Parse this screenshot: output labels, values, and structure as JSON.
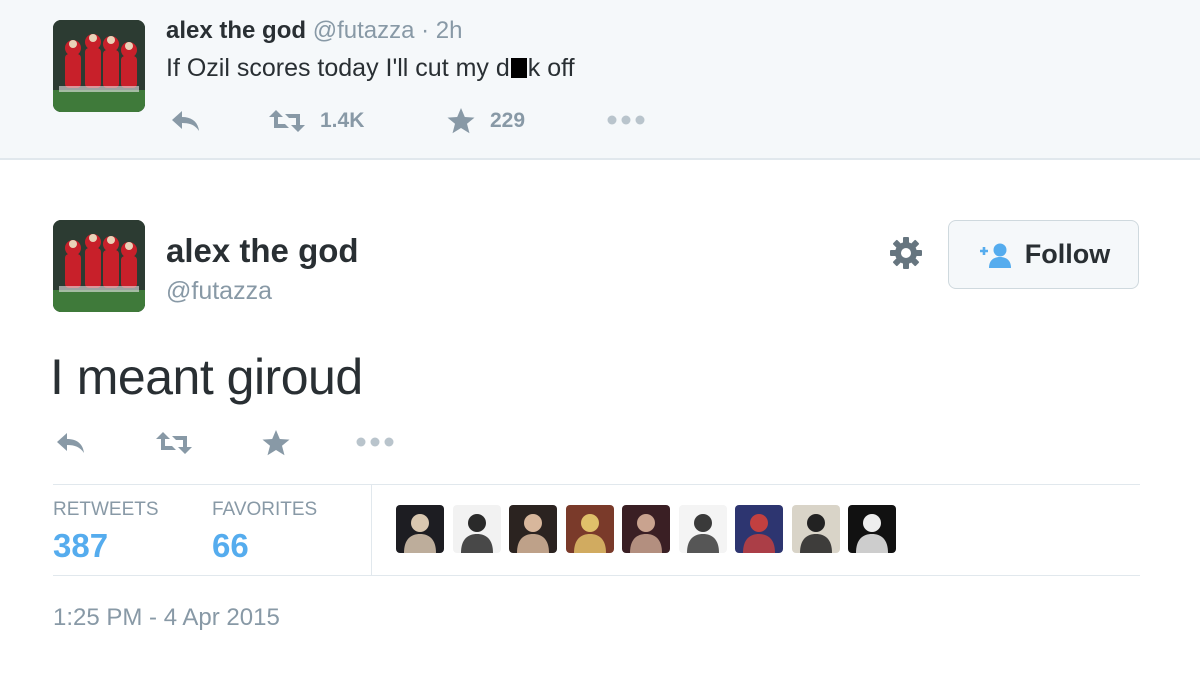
{
  "parent_tweet": {
    "name": "alex the god",
    "handle": "@futazza",
    "separator": "·",
    "time": "2h",
    "text_before": "If Ozil scores today I'll cut my d",
    "text_after": "k off",
    "retweets": "1.4K",
    "favorites": "229",
    "icons": [
      "reply-icon",
      "retweet-icon",
      "star-icon",
      "more-icon"
    ]
  },
  "main_tweet": {
    "name": "alex the god",
    "handle": "@futazza",
    "follow_label": "Follow",
    "text": "I meant giroud",
    "icons": [
      "reply-icon",
      "retweet-icon",
      "star-icon",
      "more-icon"
    ],
    "stats": {
      "retweets_label": "RETWEETS",
      "retweets_value": "387",
      "favorites_label": "FAVORITES",
      "favorites_value": "66"
    },
    "favoriters": [
      {
        "name": "favoriter-avatar-1",
        "bg": "#1d1d22",
        "fg": "#d9c7b0"
      },
      {
        "name": "favoriter-avatar-2",
        "bg": "#f2f2f2",
        "fg": "#2a2a2a"
      },
      {
        "name": "favoriter-avatar-3",
        "bg": "#2b2320",
        "fg": "#d8b79c"
      },
      {
        "name": "favoriter-avatar-4",
        "bg": "#7a3a2a",
        "fg": "#e0c06a"
      },
      {
        "name": "favoriter-avatar-5",
        "bg": "#3a1f24",
        "fg": "#c9a38f"
      },
      {
        "name": "favoriter-avatar-6",
        "bg": "#f4f4f4",
        "fg": "#3a3a3a"
      },
      {
        "name": "favoriter-avatar-7",
        "bg": "#2d3570",
        "fg": "#c24040"
      },
      {
        "name": "favoriter-avatar-8",
        "bg": "#d9d4c8",
        "fg": "#222222"
      },
      {
        "name": "favoriter-avatar-9",
        "bg": "#111111",
        "fg": "#eeeeee"
      }
    ],
    "timestamp": "1:25 PM - 4 Apr 2015"
  },
  "colors": {
    "background_top": "#f5f8fa",
    "text_primary": "#292f33",
    "text_secondary": "#8899a6",
    "accent_blue": "#55acee",
    "divider": "#e1e8ed"
  }
}
